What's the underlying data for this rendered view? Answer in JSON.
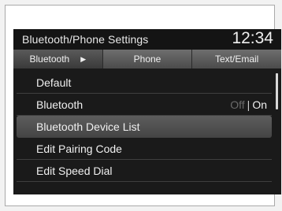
{
  "header": {
    "title": "Bluetooth/Phone Settings",
    "time": "12:34"
  },
  "tabs": [
    {
      "label": "Bluetooth",
      "active": true
    },
    {
      "label": "Phone",
      "active": false
    },
    {
      "label": "Text/Email",
      "active": false
    }
  ],
  "menu": {
    "items": [
      {
        "label": "Default"
      },
      {
        "label": "Bluetooth",
        "toggle_off": "Off",
        "toggle_sep": "|",
        "toggle_on": "On"
      },
      {
        "label": "Bluetooth Device List",
        "selected": true
      },
      {
        "label": "Edit Pairing Code"
      },
      {
        "label": "Edit Speed Dial"
      }
    ]
  },
  "icons": {
    "tab_arrow": "play-arrow-icon"
  }
}
